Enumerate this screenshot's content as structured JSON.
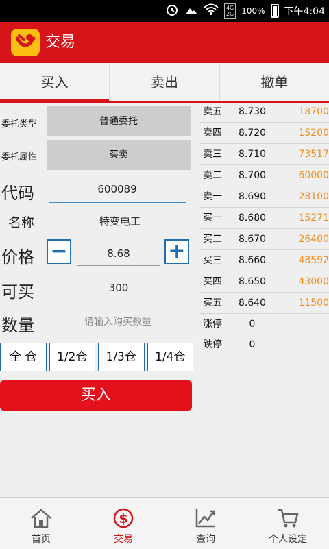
{
  "status_bar": {
    "net_top": "4G",
    "net_bottom": "2G",
    "battery": "100%",
    "time": "下午4:04"
  },
  "app": {
    "title": "交易"
  },
  "tabs": [
    {
      "label": "买入"
    },
    {
      "label": "卖出"
    },
    {
      "label": "撤单"
    }
  ],
  "form": {
    "order_type_label": "委托类型",
    "order_type_value": "普通委托",
    "order_attr_label": "委托属性",
    "order_attr_value": "买卖",
    "code_label": "代码",
    "code_value": "600089",
    "name_label": "名称",
    "name_value": "特变电工",
    "price_label": "价格",
    "price_value": "8.68",
    "avail_label": "可买",
    "avail_value": "300",
    "qty_label": "数量",
    "qty_placeholder": "请输入购买数量",
    "position_buttons": [
      "全 仓",
      "1/2仓",
      "1/3仓",
      "1/4仓"
    ],
    "submit_label": "买入"
  },
  "quotes": [
    {
      "name": "卖五",
      "price": "8.730",
      "volume": "18700"
    },
    {
      "name": "卖四",
      "price": "8.720",
      "volume": "15200"
    },
    {
      "name": "卖三",
      "price": "8.710",
      "volume": "73517"
    },
    {
      "name": "卖二",
      "price": "8.700",
      "volume": "60000"
    },
    {
      "name": "卖一",
      "price": "8.690",
      "volume": "28100"
    },
    {
      "name": "买一",
      "price": "8.680",
      "volume": "15271"
    },
    {
      "name": "买二",
      "price": "8.670",
      "volume": "26400"
    },
    {
      "name": "买三",
      "price": "8.660",
      "volume": "48592"
    },
    {
      "name": "买四",
      "price": "8.650",
      "volume": "43000"
    },
    {
      "name": "买五",
      "price": "8.640",
      "volume": "11500"
    }
  ],
  "limits": [
    {
      "name": "涨停",
      "price": "0"
    },
    {
      "name": "跌停",
      "price": "0"
    }
  ],
  "bottom_nav": [
    {
      "label": "首页",
      "icon": "home-icon"
    },
    {
      "label": "交易",
      "icon": "dollar-icon"
    },
    {
      "label": "查询",
      "icon": "chart-icon"
    },
    {
      "label": "个人设定",
      "icon": "cart-icon"
    }
  ],
  "colors": {
    "brand_red": "#d8141b",
    "volume_orange": "#f08d1a",
    "accent_blue": "#1e6fb4"
  }
}
